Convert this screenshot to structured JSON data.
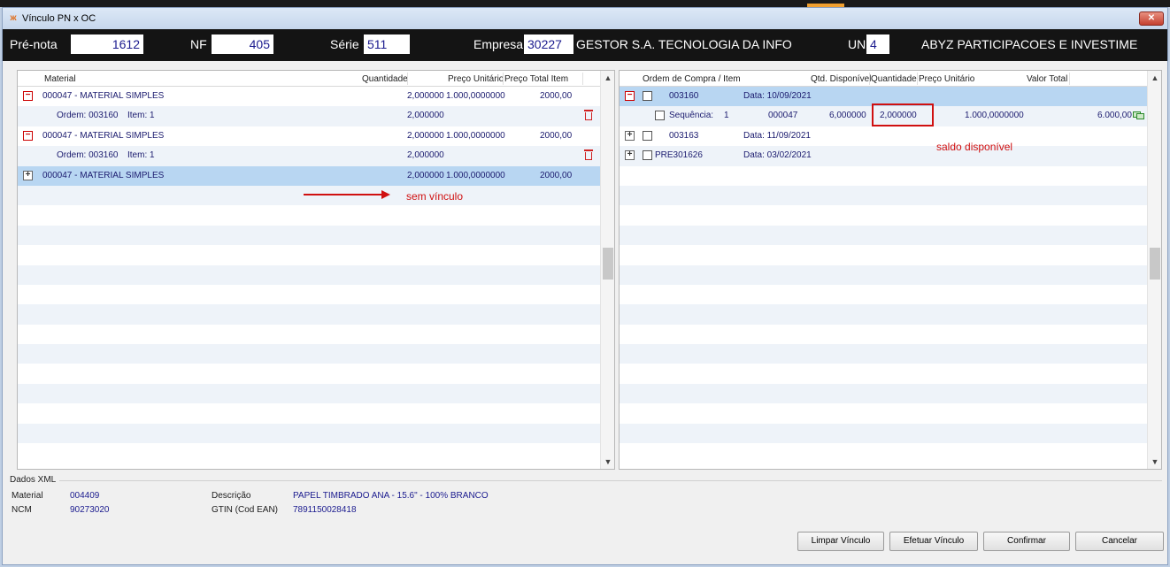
{
  "window": {
    "title": "Vínculo PN x OC"
  },
  "header": {
    "prenota_label": "Pré-nota",
    "prenota_value": "1612",
    "nf_label": "NF",
    "nf_value": "405",
    "serie_label": "Série",
    "serie_value": "511",
    "empresa_label": "Empresa",
    "empresa_code": "30227",
    "empresa_name": "GESTOR S.A. TECNOLOGIA DA INFO",
    "un_label": "UN",
    "un_code": "4",
    "un_name": "ABYZ PARTICIPACOES E INVESTIME"
  },
  "left_grid": {
    "columns": [
      "Material",
      "Quantidade",
      "Preço Unitário",
      "Preço Total Item"
    ],
    "rows": [
      {
        "type": "material",
        "material": "000047 - MATERIAL SIMPLES",
        "quantidade": "2,000000",
        "preco_unitario": "1.000,0000000",
        "preco_total": "2000,00"
      },
      {
        "type": "ordem",
        "ordem": "Ordem: 003160",
        "item": "Item: 1",
        "quantidade": "2,000000"
      },
      {
        "type": "material",
        "material": "000047 - MATERIAL SIMPLES",
        "quantidade": "2,000000",
        "preco_unitario": "1.000,0000000",
        "preco_total": "2000,00"
      },
      {
        "type": "ordem",
        "ordem": "Ordem: 003160",
        "item": "Item: 1",
        "quantidade": "2,000000"
      },
      {
        "type": "material_collapsed",
        "material": "000047 - MATERIAL SIMPLES",
        "quantidade": "2,000000",
        "preco_unitario": "1.000,0000000",
        "preco_total": "2000,00"
      }
    ]
  },
  "right_grid": {
    "columns": [
      "Ordem de Compra / Item",
      "Qtd. Disponível",
      "Quantidade",
      "Preço Unitário",
      "Valor Total"
    ],
    "rows": [
      {
        "type": "ordem_expanded",
        "ordem": "003160",
        "data": "Data: 10/09/2021"
      },
      {
        "type": "sequencia",
        "label": "Sequência:",
        "seq": "1",
        "material": "000047",
        "qtd_disponivel": "6,000000",
        "quantidade": "2,000000",
        "preco_unitario": "1.000,0000000",
        "valor_total": "6.000,00"
      },
      {
        "type": "ordem_collapsed",
        "ordem": "003163",
        "data": "Data: 11/09/2021"
      },
      {
        "type": "ordem_collapsed",
        "ordem": "PRE301626",
        "data": "Data: 03/02/2021"
      }
    ]
  },
  "annotations": {
    "sem_vinculo": "sem vínculo",
    "saldo_disponivel": "saldo disponível"
  },
  "xml": {
    "legend": "Dados XML",
    "material_label": "Material",
    "material_value": "004409",
    "ncm_label": "NCM",
    "ncm_value": "90273020",
    "descricao_label": "Descrição",
    "descricao_value": "PAPEL TIMBRADO ANA - 15.6\" - 100% BRANCO",
    "gtin_label": "GTIN (Cod EAN)",
    "gtin_value": "7891150028418"
  },
  "buttons": {
    "limpar": "Limpar Vínculo",
    "efetuar": "Efetuar Vínculo",
    "confirmar": "Confirmar",
    "cancelar": "Cancelar"
  },
  "colors": {
    "header_bg": "#141414",
    "selected_row": "#b8d6f2",
    "annotation": "#d01010",
    "link_text": "#1a1a8e"
  }
}
